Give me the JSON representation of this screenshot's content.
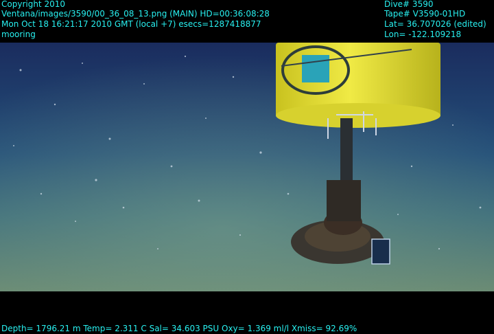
{
  "overlay": {
    "copyright": "Copyright 2010",
    "image_path": "Ventana/images/3590/00_36_08_13.png (MAIN)  HD=00:36:08:28",
    "datetime": "Mon Oct 18 16:21:17 2010 GMT (local +7)  esecs=1287418877",
    "label": "mooring",
    "dive": "Dive# 3590",
    "tape": "Tape# V3590-01HD",
    "lat": "Lat= 36.707026 (edited)",
    "lon": "Lon= -122.109218",
    "sensors": "Depth= 1796.21 m  Temp= 2.311 C  Sal= 34.603 PSU  Oxy= 1.369 ml/l  Xmiss= 92.69%"
  },
  "scene": {
    "subject": "mooring float on seafloor",
    "water_color": "#1e3f6e",
    "seafloor_color": "#5a7d6a",
    "float_color": "#e6e13a"
  }
}
